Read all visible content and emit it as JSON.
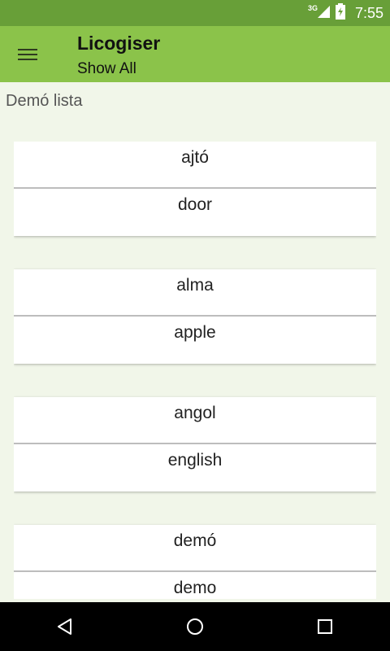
{
  "status_bar": {
    "network": "3G",
    "time": "7:55"
  },
  "app_bar": {
    "title": "Licogiser",
    "subtitle": "Show All"
  },
  "list": {
    "name": "Demó lista",
    "cards": [
      {
        "word": "ajtó",
        "translation": "door"
      },
      {
        "word": "alma",
        "translation": "apple"
      },
      {
        "word": "angol",
        "translation": "english"
      },
      {
        "word": "demó",
        "translation": "demo"
      }
    ]
  },
  "colors": {
    "status_bar": "#689f38",
    "app_bar": "#8bc34a",
    "background": "#f1f6e9"
  },
  "icons": [
    "hamburger-menu-icon",
    "signal-icon",
    "battery-icon",
    "back-icon",
    "home-icon",
    "recents-icon"
  ]
}
